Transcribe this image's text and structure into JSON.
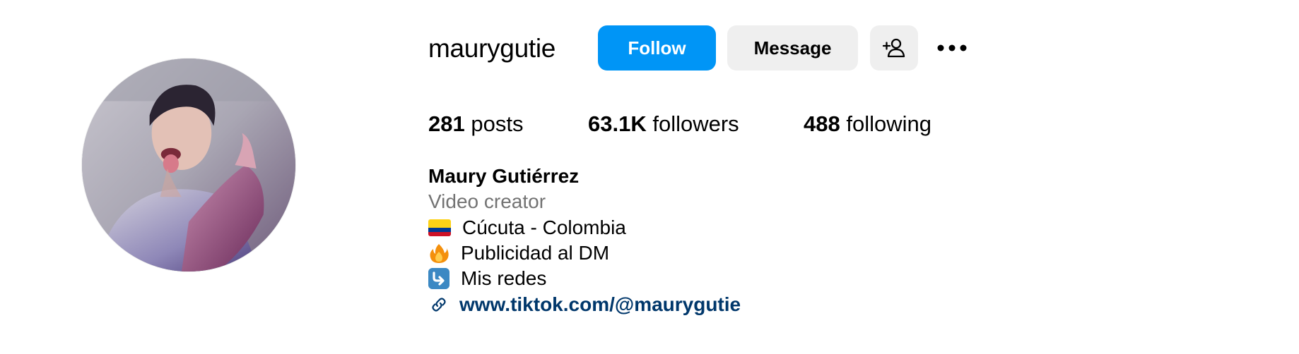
{
  "profile": {
    "username": "maurygutie",
    "follow_label": "Follow",
    "message_label": "Message",
    "add_user_icon": "add-user-icon",
    "more_icon": "more-options-icon",
    "avatar_icon": "profile-photo"
  },
  "stats": {
    "posts_count": "281",
    "posts_label": "posts",
    "followers_count": "63.1K",
    "followers_label": "followers",
    "following_count": "488",
    "following_label": "following"
  },
  "bio": {
    "name": "Maury Gutiérrez",
    "category": "Video creator",
    "lines": [
      {
        "icon": "colombia-flag-icon",
        "text": "Cúcuta - Colombia"
      },
      {
        "icon": "fire-icon",
        "text": "Publicidad al DM"
      },
      {
        "icon": "arrow-down-right-icon",
        "text": "Mis redes"
      }
    ],
    "link_icon": "link-icon",
    "link": "www.tiktok.com/@maurygutie"
  },
  "colors": {
    "follow_button": "#0095f6",
    "secondary_button": "#efefef",
    "category_text": "#737373",
    "link_text": "#00376b"
  }
}
